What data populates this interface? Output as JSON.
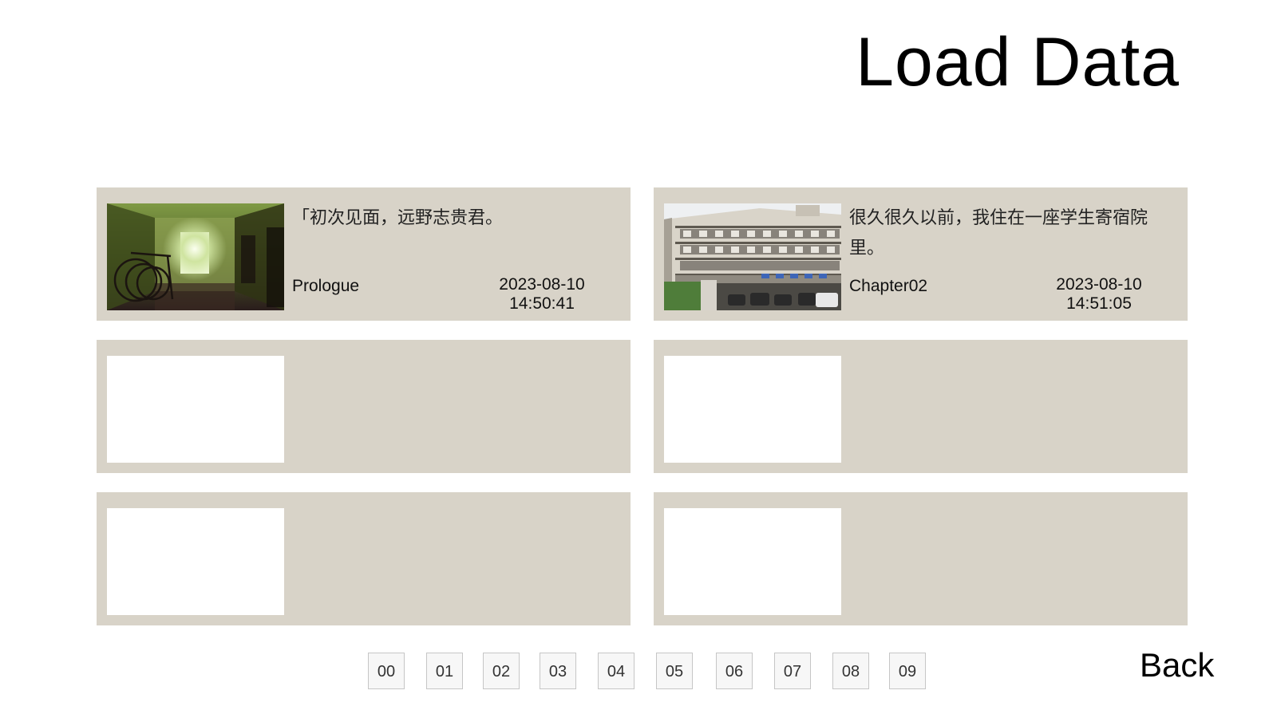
{
  "title": "Load Data",
  "slots": [
    {
      "text": "「初次见面，远野志贵君。",
      "chapter": "Prologue",
      "date": "2023-08-10",
      "time": "14:50:41",
      "thumbnail": "hospital-room-image"
    },
    {
      "text": "很久很久以前，我住在一座学生寄宿院里。",
      "chapter": "Chapter02",
      "date": "2023-08-10",
      "time": "14:51:05",
      "thumbnail": "dormitory-building-image"
    },
    {
      "text": "",
      "chapter": "",
      "date": "",
      "time": "",
      "thumbnail": "empty"
    },
    {
      "text": "",
      "chapter": "",
      "date": "",
      "time": "",
      "thumbnail": "empty"
    },
    {
      "text": "",
      "chapter": "",
      "date": "",
      "time": "",
      "thumbnail": "empty"
    },
    {
      "text": "",
      "chapter": "",
      "date": "",
      "time": "",
      "thumbnail": "empty"
    }
  ],
  "pages": [
    "00",
    "01",
    "02",
    "03",
    "04",
    "05",
    "06",
    "07",
    "08",
    "09"
  ],
  "back_label": "Back",
  "colors": {
    "slot_bg": "#d8d3c8",
    "thumb_empty": "#ffffff",
    "page_btn_bg": "#f7f7f7",
    "page_btn_border": "#c6c6c6"
  }
}
